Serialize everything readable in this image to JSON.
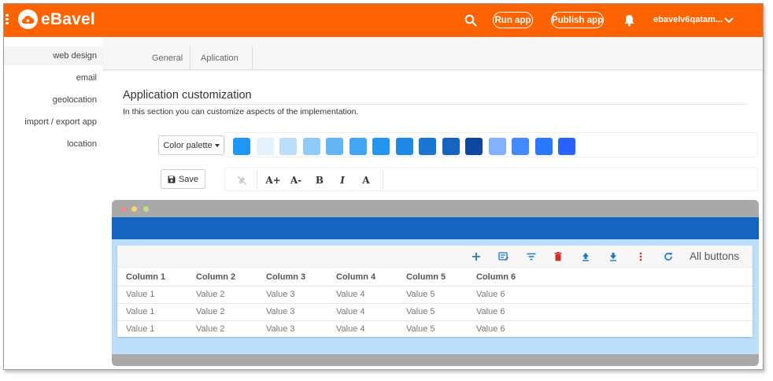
{
  "app": {
    "name": "eBavel"
  },
  "header": {
    "run_label": "Run app",
    "publish_label": "Publish app",
    "user": "ebavelv6qatam..."
  },
  "sidebar": {
    "items": [
      {
        "label": "web design"
      },
      {
        "label": "email"
      },
      {
        "label": "geolocation"
      },
      {
        "label": "import / export app"
      },
      {
        "label": "location"
      }
    ]
  },
  "tabs": [
    {
      "label": "General"
    },
    {
      "label": "Aplication"
    }
  ],
  "main": {
    "title": "Application customization",
    "subtitle": "In this section you can customize aspects of the implementation.",
    "palette_label": "Color palette",
    "save_label": "Save"
  },
  "palette": {
    "colors": [
      "#2196f3",
      "#e3f2fd",
      "#bbdefb",
      "#90caf9",
      "#64b5f6",
      "#42a5f5",
      "#2196f3",
      "#1e88e5",
      "#1976d2",
      "#1565c0",
      "#0d47a1",
      "#82b1ff",
      "#448aff",
      "#2979ff",
      "#2962ff"
    ]
  },
  "font_tools": {
    "increase": "A+",
    "decrease": "A-",
    "bold": "B",
    "italic": "I",
    "color": "A"
  },
  "preview": {
    "all_buttons_label": "All buttons",
    "columns": [
      "Column 1",
      "Column 2",
      "Column 3",
      "Column 4",
      "Column 5",
      "Column 6"
    ],
    "rows": [
      [
        "Value 1",
        "Value 2",
        "Value 3",
        "Value 4",
        "Value 5",
        "Value 6"
      ],
      [
        "Value 1",
        "Value 2",
        "Value 3",
        "Value 4",
        "Value 5",
        "Value 6"
      ],
      [
        "Value 1",
        "Value 2",
        "Value 3",
        "Value 4",
        "Value 5",
        "Value 6"
      ]
    ]
  },
  "colors": {
    "brand": "#ff6200",
    "preview_header": "#1565c0",
    "preview_body": "#bbdefb",
    "toolbar_icon": "#1976d2",
    "delete_icon": "#d32f2f"
  }
}
